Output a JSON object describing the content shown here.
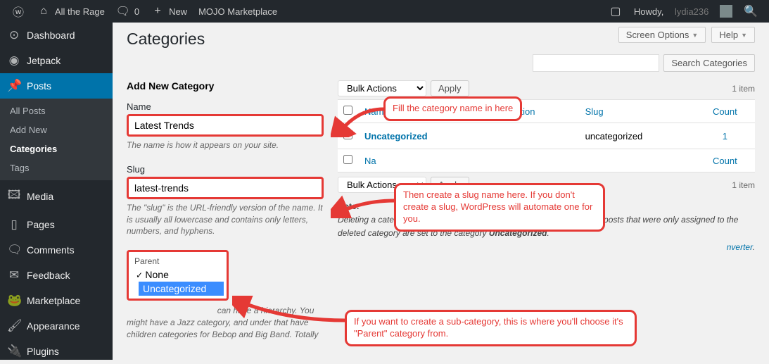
{
  "topbar": {
    "site": "All the Rage",
    "comments": "0",
    "new": "New",
    "mojo": "MOJO Marketplace",
    "howdy": "Howdy,",
    "user": "lydia236"
  },
  "sidebar": {
    "dashboard": "Dashboard",
    "jetpack": "Jetpack",
    "posts": "Posts",
    "sub_all": "All Posts",
    "sub_add": "Add New",
    "sub_cat": "Categories",
    "sub_tag": "Tags",
    "media": "Media",
    "pages": "Pages",
    "comments": "Comments",
    "feedback": "Feedback",
    "marketplace": "Marketplace",
    "appearance": "Appearance",
    "plugins": "Plugins"
  },
  "page": {
    "title": "Categories",
    "screen_opts": "Screen Options",
    "help": "Help",
    "search_btn": "Search Categories"
  },
  "form": {
    "heading": "Add New Category",
    "name_label": "Name",
    "name_val": "Latest Trends",
    "name_desc": "The name is how it appears on your site.",
    "slug_label": "Slug",
    "slug_val": "latest-trends",
    "slug_desc": "The \"slug\" is the URL-friendly version of the name. It is usually all lowercase and contains only letters, numbers, and hyphens.",
    "parent_label": "Parent",
    "parent_none": "None",
    "parent_uncat": "Uncategorized",
    "parent_desc": "can have a hierarchy. You might have a Jazz category, and under that have children categories for Bebop and Big Band. Totally"
  },
  "table": {
    "bulk": "Bulk Actions",
    "apply": "Apply",
    "items": "1 item",
    "h_name": "Name",
    "h_desc": "Description",
    "h_slug": "Slug",
    "h_count": "Count",
    "row_name": "Uncategorized",
    "row_slug": "uncategorized",
    "row_count": "1",
    "h2_na": "Na",
    "h2_count": "Count"
  },
  "note": {
    "title": "Note:",
    "body1": "Deleting a category does not delete the posts in that category. Instead, posts that were only assigned to the deleted category are set to the category ",
    "uncat": "Uncategorized",
    "conv": "nverter"
  },
  "callouts": {
    "c1": "Fill the category name in here",
    "c2": "Then create a slug name here. If you don't create a slug, WordPress will automate one for you.",
    "c3": "If you want to create a sub-category, this is where you'll choose it's \"Parent\" category from."
  }
}
